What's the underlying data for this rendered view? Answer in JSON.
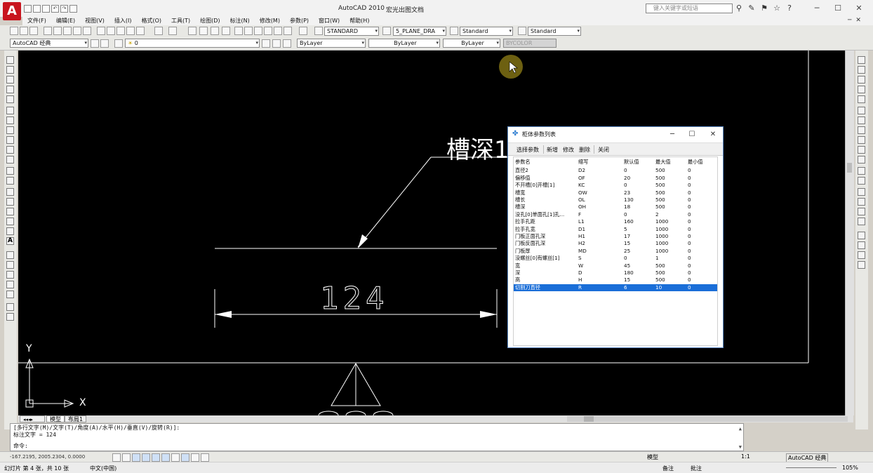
{
  "window": {
    "app_title": "AutoCAD 2010",
    "doc_title": "宏光出图文档",
    "search_placeholder": "键入关键字或短语",
    "logo_letter": "A",
    "min": "─",
    "max": "☐",
    "close": "✕"
  },
  "menu": [
    "文件(F)",
    "编辑(E)",
    "视图(V)",
    "插入(I)",
    "格式(O)",
    "工具(T)",
    "绘图(D)",
    "标注(N)",
    "修改(M)",
    "参数(P)",
    "窗口(W)",
    "帮助(H)"
  ],
  "toolbar": {
    "text_style": "STANDARD",
    "dim_style": "5_PLANE_DRA",
    "table_style": "Standard",
    "mleader_style": "Standard",
    "workspace": "AutoCAD 经典",
    "layer": "0",
    "color": "ByLayer",
    "linetype": "ByLayer",
    "lineweight": "ByLayer",
    "plotstyle": "BYCOLOR"
  },
  "drawing": {
    "label_text": "槽深1",
    "dim_value": "124",
    "axis_y": "Y",
    "axis_x": "X"
  },
  "layout_tabs": [
    "模型",
    "布局1"
  ],
  "dialog": {
    "title": "柜体参数列表",
    "buttons": [
      "选择参数",
      "新增",
      "修改",
      "删除",
      "关闭"
    ],
    "columns": [
      "参数名",
      "缩写",
      "默认值",
      "最大值",
      "最小值"
    ],
    "rows": [
      [
        "直径2",
        "D2",
        "0",
        "500",
        "0"
      ],
      [
        "偏移值",
        "OF",
        "20",
        "500",
        "0"
      ],
      [
        "不开槽[0]开槽[1]",
        "KC",
        "0",
        "500",
        "0"
      ],
      [
        "槽宽",
        "OW",
        "23",
        "500",
        "0"
      ],
      [
        "槽长",
        "OL",
        "130",
        "500",
        "0"
      ],
      [
        "槽深",
        "OH",
        "18",
        "500",
        "0"
      ],
      [
        "没孔[0]单面孔[1]孔...",
        "F",
        "0",
        "2",
        "0"
      ],
      [
        "拉手孔距",
        "L1",
        "160",
        "1000",
        "0"
      ],
      [
        "拉手孔宽",
        "D1",
        "5",
        "1000",
        "0"
      ],
      [
        "门板正面孔深",
        "H1",
        "17",
        "1000",
        "0"
      ],
      [
        "门板反面孔深",
        "H2",
        "15",
        "1000",
        "0"
      ],
      [
        "门板厚",
        "MD",
        "25",
        "1000",
        "0"
      ],
      [
        "没螺丝[0]有螺丝[1]",
        "S",
        "0",
        "1",
        "0"
      ],
      [
        "宽",
        "W",
        "45",
        "500",
        "0"
      ],
      [
        "深",
        "D",
        "180",
        "500",
        "0"
      ],
      [
        "高",
        "H",
        "15",
        "500",
        "0"
      ],
      [
        "切割刀直径",
        "R",
        "6",
        "10",
        "0"
      ]
    ],
    "selected_row": 16,
    "selection_color": "#1a6ed8"
  },
  "command": {
    "line1": "[多行文字(M)/文字(T)/角度(A)/水平(H)/垂直(V)/旋转(R)]:",
    "line2": "标注文字 = 124",
    "prompt": "命令:"
  },
  "status": {
    "coords": "-167.2195, 2005.2304, 0.0000",
    "model": "模型",
    "scale": "1:1",
    "workspace": "AutoCAD 经典"
  },
  "taskbar": {
    "slide": "幻灯片 第 4 张，共 10 张",
    "lang": "中文(中国)",
    "notes": "备注",
    "comments": "批注",
    "zoom": "105%"
  },
  "colors": {
    "canvas": "#000000",
    "accent": "#c8141e",
    "cursor_halo": "#d7b92a"
  }
}
